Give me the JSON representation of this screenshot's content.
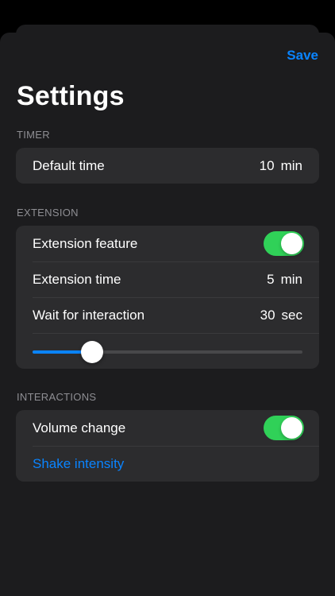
{
  "header": {
    "save_label": "Save",
    "title": "Settings"
  },
  "sections": {
    "timer": {
      "header": "TIMER",
      "default_time": {
        "label": "Default time",
        "value": "10",
        "unit": "min"
      }
    },
    "extension": {
      "header": "EXTENSION",
      "feature": {
        "label": "Extension feature",
        "enabled": true
      },
      "time": {
        "label": "Extension time",
        "value": "5",
        "unit": "min"
      },
      "wait": {
        "label": "Wait for interaction",
        "value": "30",
        "unit": "sec"
      },
      "wait_slider_fraction": 0.22
    },
    "interactions": {
      "header": "INTERACTIONS",
      "volume": {
        "label": "Volume change",
        "enabled": true
      },
      "shake_label": "Shake intensity"
    }
  },
  "colors": {
    "accent": "#0a84ff",
    "toggle_on": "#30d158",
    "background": "#1c1c1e",
    "cell": "#2c2c2e"
  }
}
